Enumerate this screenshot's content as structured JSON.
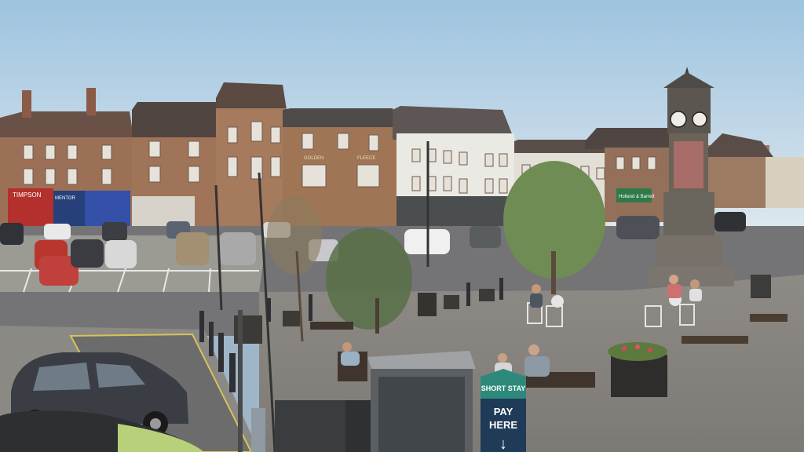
{
  "scene": {
    "description_kind": "webcam-view",
    "shop_signs": {
      "timpson": "TIMPSON",
      "mentor": "MENTOR",
      "shop3": "",
      "golden_left": "GOLDEN",
      "fleece_right": "FLEECE",
      "holland": "Holland & Barrett"
    },
    "parking_sign": {
      "line1": "SHORT STAY",
      "line2": "PAY",
      "line3": "HERE",
      "arrow": "↓"
    },
    "colors": {
      "sky_top": "#9dc3df",
      "sky_bottom": "#dde7ee",
      "brick": "#9a6f55",
      "roof": "#5a4a42",
      "road": "#6f6f70",
      "paving": "#8c8780",
      "tree": "#6f8a55",
      "sign_green": "#2d8a7a",
      "sign_navy": "#1f3b57"
    }
  }
}
